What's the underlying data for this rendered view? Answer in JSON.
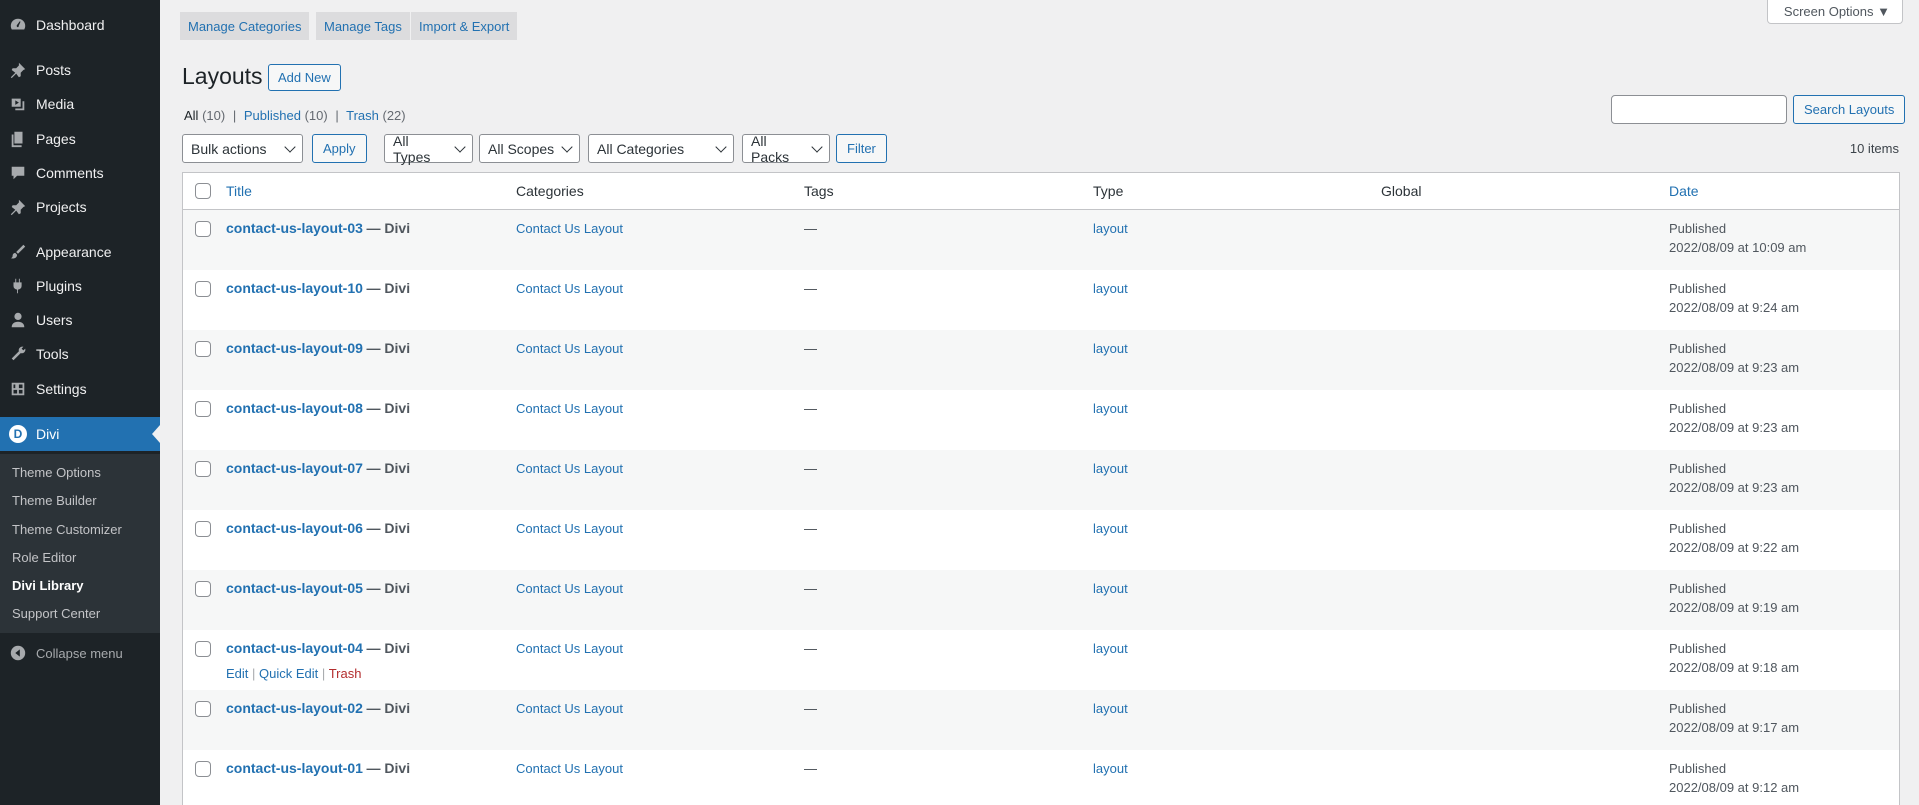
{
  "sidebar": {
    "menu": [
      {
        "label": "Dashboard",
        "icon": "dashboard-icon"
      },
      {
        "label": "Posts",
        "icon": "pushpin-icon"
      },
      {
        "label": "Media",
        "icon": "media-icon"
      },
      {
        "label": "Pages",
        "icon": "pages-icon"
      },
      {
        "label": "Comments",
        "icon": "comment-icon"
      },
      {
        "label": "Projects",
        "icon": "pushpin-icon"
      },
      {
        "label": "Appearance",
        "icon": "paintbrush-icon"
      },
      {
        "label": "Plugins",
        "icon": "plugin-icon"
      },
      {
        "label": "Users",
        "icon": "users-icon"
      },
      {
        "label": "Tools",
        "icon": "wrench-icon"
      },
      {
        "label": "Settings",
        "icon": "settings-icon"
      },
      {
        "label": "Divi",
        "icon": "divi-icon"
      }
    ],
    "submenu": [
      "Theme Options",
      "Theme Builder",
      "Theme Customizer",
      "Role Editor",
      "Divi Library",
      "Support Center"
    ],
    "collapse_label": "Collapse menu",
    "divi_letter": "D"
  },
  "top_tabs": [
    "Manage Categories",
    "Manage Tags",
    "Import & Export"
  ],
  "screen_options_label": "Screen Options ▼",
  "page_title": "Layouts",
  "add_new_label": "Add New",
  "views": {
    "all": "All",
    "all_count": "(10)",
    "published": "Published",
    "published_count": "(10)",
    "trash": "Trash",
    "trash_count": "(22)",
    "separator": "|"
  },
  "search": {
    "button_label": "Search Layouts",
    "value": ""
  },
  "filters": {
    "bulk_actions": "Bulk actions",
    "apply": "Apply",
    "types": "All Types",
    "scopes": "All Scopes",
    "categories": "All Categories",
    "packs": "All Packs",
    "filter": "Filter"
  },
  "items_count": "10 items",
  "table": {
    "columns": {
      "title": "Title",
      "categories": "Categories",
      "tags": "Tags",
      "type": "Type",
      "global": "Global",
      "date": "Date"
    },
    "rows": [
      {
        "title": "contact-us-layout-03",
        "suffix": "— Divi",
        "category": "Contact Us Layout",
        "tags": "—",
        "type": "layout",
        "status": "Published",
        "date": "2022/08/09 at 10:09 am"
      },
      {
        "title": "contact-us-layout-10",
        "suffix": "— Divi",
        "category": "Contact Us Layout",
        "tags": "—",
        "type": "layout",
        "status": "Published",
        "date": "2022/08/09 at 9:24 am"
      },
      {
        "title": "contact-us-layout-09",
        "suffix": "— Divi",
        "category": "Contact Us Layout",
        "tags": "—",
        "type": "layout",
        "status": "Published",
        "date": "2022/08/09 at 9:23 am"
      },
      {
        "title": "contact-us-layout-08",
        "suffix": "— Divi",
        "category": "Contact Us Layout",
        "tags": "—",
        "type": "layout",
        "status": "Published",
        "date": "2022/08/09 at 9:23 am"
      },
      {
        "title": "contact-us-layout-07",
        "suffix": "— Divi",
        "category": "Contact Us Layout",
        "tags": "—",
        "type": "layout",
        "status": "Published",
        "date": "2022/08/09 at 9:23 am"
      },
      {
        "title": "contact-us-layout-06",
        "suffix": "— Divi",
        "category": "Contact Us Layout",
        "tags": "—",
        "type": "layout",
        "status": "Published",
        "date": "2022/08/09 at 9:22 am"
      },
      {
        "title": "contact-us-layout-05",
        "suffix": "— Divi",
        "category": "Contact Us Layout",
        "tags": "—",
        "type": "layout",
        "status": "Published",
        "date": "2022/08/09 at 9:19 am"
      },
      {
        "title": "contact-us-layout-04",
        "suffix": "— Divi",
        "category": "Contact Us Layout",
        "tags": "—",
        "type": "layout",
        "status": "Published",
        "date": "2022/08/09 at 9:18 am"
      },
      {
        "title": "contact-us-layout-02",
        "suffix": "— Divi",
        "category": "Contact Us Layout",
        "tags": "—",
        "type": "layout",
        "status": "Published",
        "date": "2022/08/09 at 9:17 am"
      },
      {
        "title": "contact-us-layout-01",
        "suffix": "— Divi",
        "category": "Contact Us Layout",
        "tags": "—",
        "type": "layout",
        "status": "Published",
        "date": "2022/08/09 at 9:12 am"
      }
    ],
    "row_actions": {
      "edit": "Edit",
      "quick_edit": "Quick Edit",
      "trash": "Trash",
      "separator": "|"
    }
  }
}
